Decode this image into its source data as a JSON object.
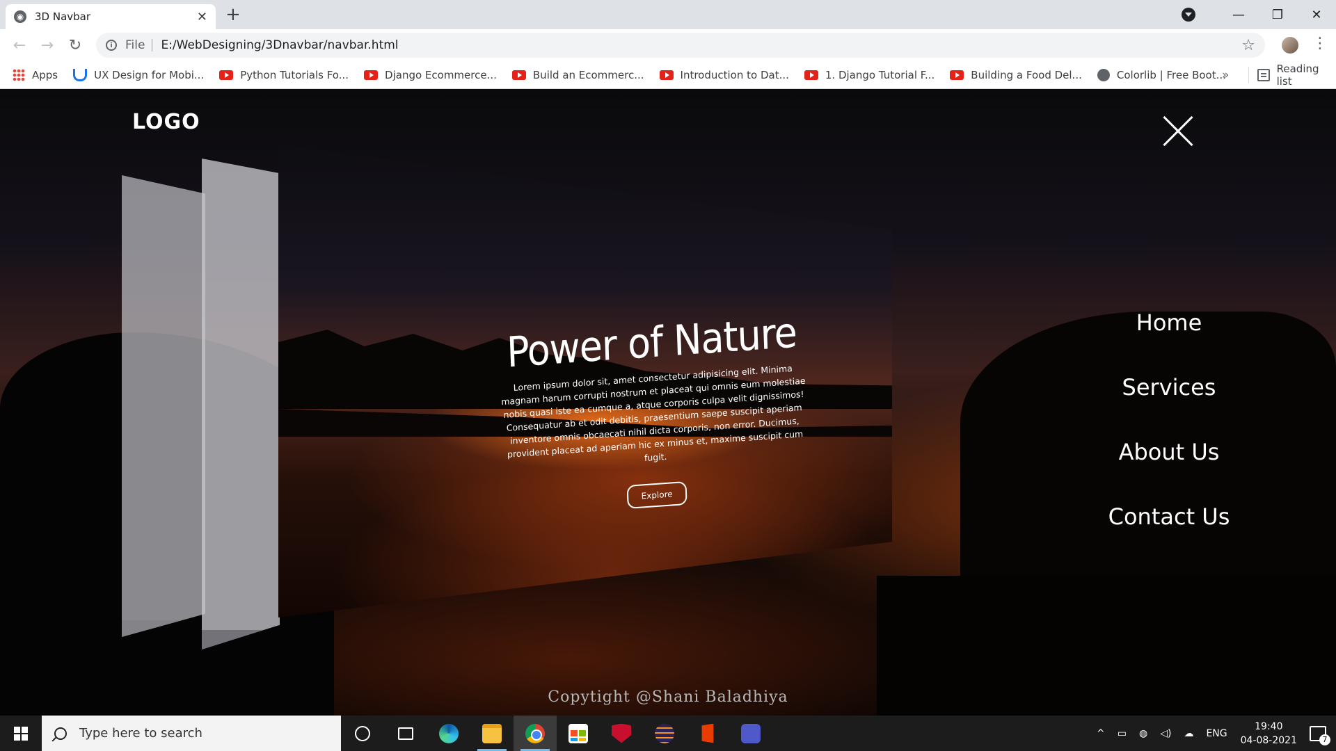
{
  "browser": {
    "tab_title": "3D Navbar",
    "tab_icon": "globe-icon",
    "new_tab": "+",
    "address_prefix": "File",
    "url": "E:/WebDesigning/3Dnavbar/navbar.html",
    "bookmarks": [
      {
        "label": "Apps",
        "icon": "apps-grid-icon"
      },
      {
        "label": "UX Design for Mobi...",
        "icon": "udacity-icon"
      },
      {
        "label": "Python Tutorials Fo...",
        "icon": "youtube-icon"
      },
      {
        "label": "Django Ecommerce...",
        "icon": "youtube-icon"
      },
      {
        "label": "Build an Ecommerc...",
        "icon": "youtube-icon"
      },
      {
        "label": "Introduction to Dat...",
        "icon": "youtube-icon"
      },
      {
        "label": "1. Django Tutorial F...",
        "icon": "youtube-icon"
      },
      {
        "label": "Building a Food Del...",
        "icon": "youtube-icon"
      },
      {
        "label": "Colorlib | Free Boot...",
        "icon": "globe-icon"
      }
    ],
    "bookmarks_more": "»",
    "reading_list": "Reading list"
  },
  "page": {
    "logo": "LOGO",
    "hero_title": "Power of Nature",
    "hero_text": "Lorem ipsum dolor sit, amet consectetur adipisicing elit. Minima magnam harum corrupti nostrum et placeat qui omnis eum molestiae nobis quasi iste ea cumque a, atque corporis culpa velit dignissimos! Consequatur ab et odit debitis, praesentium saepe suscipit aperiam inventore omnis obcaecati nihil dicta corporis, non error. Ducimus, provident placeat ad aperiam hic ex minus et, maxime suscipit cum fugit.",
    "explore_label": "Explore",
    "menu": [
      "Home",
      "Services",
      "About Us",
      "Contact Us"
    ],
    "copyright": "Copytight @Shani Baladhiya",
    "colors": {
      "accent_orange": "#d7621a",
      "text": "#ffffff"
    }
  },
  "taskbar": {
    "search_placeholder": "Type here to search",
    "language": "ENG",
    "time": "19:40",
    "date": "04-08-2021",
    "notification_count": "7",
    "tray_chevron": "^"
  }
}
